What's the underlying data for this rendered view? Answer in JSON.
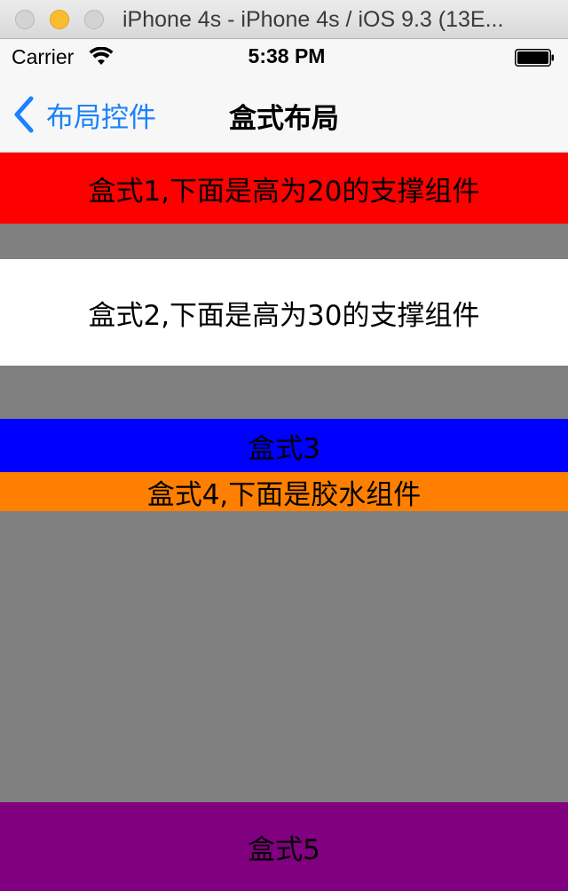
{
  "window": {
    "title": "iPhone 4s - iPhone 4s / iOS 9.3 (13E..."
  },
  "status_bar": {
    "carrier": "Carrier",
    "time": "5:38 PM",
    "wifi_icon": "wifi-icon",
    "battery_icon": "battery-icon"
  },
  "nav_bar": {
    "back_label": "布局控件",
    "back_icon": "chevron-left-icon",
    "title": "盒式布局",
    "tint_color": "#1a82fb"
  },
  "boxes": [
    {
      "label": "盒式1,下面是高为20的支撑组件",
      "color": "#ff0000"
    },
    {
      "label": "盒式2,下面是高为30的支撑组件",
      "color": "#ffffff"
    },
    {
      "label": "盒式3",
      "color": "#0000ff"
    },
    {
      "label": "盒式4,下面是胶水组件",
      "color": "#ff8000"
    },
    {
      "label": "盒式5",
      "color": "#800080"
    }
  ],
  "background_color": "#808080"
}
